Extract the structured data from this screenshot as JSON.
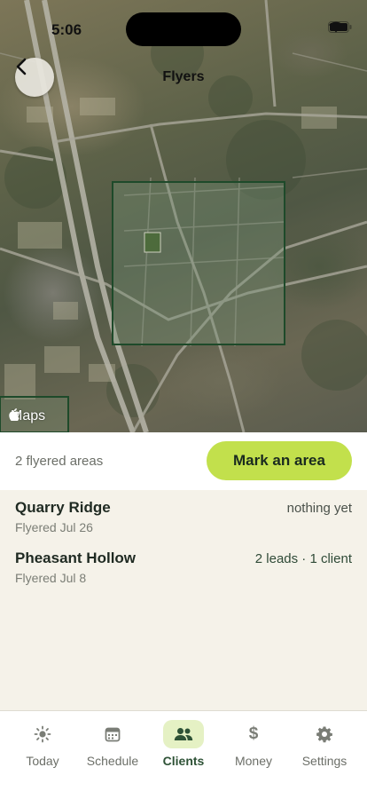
{
  "status_bar": {
    "time": "5:06"
  },
  "header": {
    "title": "Flyers"
  },
  "map": {
    "attribution": "Maps"
  },
  "summary": {
    "count_text": "2 flyered areas",
    "mark_button_label": "Mark an area"
  },
  "areas": [
    {
      "name": "Quarry Ridge",
      "date": "Flyered Jul 26",
      "status": "nothing yet"
    },
    {
      "name": "Pheasant Hollow",
      "date": "Flyered Jul 8",
      "status": "2 leads · 1 client"
    }
  ],
  "tabs": [
    {
      "label": "Today",
      "icon": "sun-icon"
    },
    {
      "label": "Schedule",
      "icon": "calendar-icon"
    },
    {
      "label": "Clients",
      "icon": "people-icon",
      "active": true
    },
    {
      "label": "Money",
      "icon": "dollar-icon"
    },
    {
      "label": "Settings",
      "icon": "gear-icon"
    }
  ],
  "colors": {
    "accent": "#c2e04c",
    "active_tab_bg": "#e5f1c4",
    "active_tab_text": "#2e5236",
    "area_outline": "#1e4a2a"
  }
}
